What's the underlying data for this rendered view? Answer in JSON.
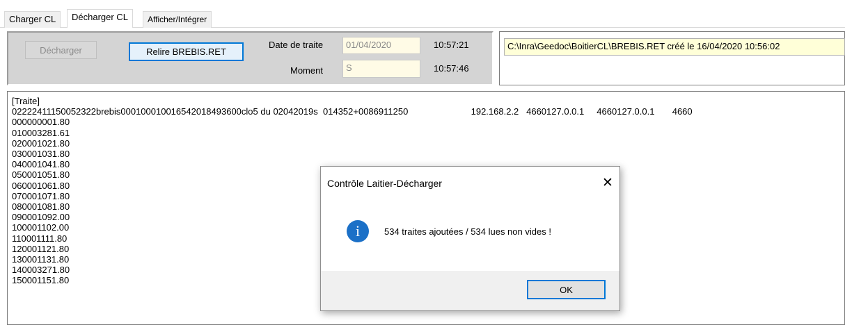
{
  "tabs": [
    {
      "label": "Charger CL"
    },
    {
      "label": "Décharger CL"
    },
    {
      "label": "Afficher/Intégrer"
    }
  ],
  "toolbar": {
    "decharger_label": "Décharger",
    "relire_label": "Relire BREBIS.RET",
    "date_label": "Date de traite",
    "date_value": "01/04/2020",
    "time1": "10:57:21",
    "moment_label": "Moment",
    "moment_value": "S",
    "time2": "10:57:46"
  },
  "status_path": "C:\\Inra\\Geedoc\\BoitierCL\\BREBIS.RET créé le 16/04/2020 10:56:02",
  "log_lines": [
    "[Traite]",
    "02222411150052322brebis00010001001654201849360​0clo5 du 02042019s  014352+0086911250                         192.168.2.2   4660127.0.0.1     4660127.0.0.1       4660",
    "000000001.80",
    "010003281.61",
    "020001021.80",
    "030001031.80",
    "040001041.80",
    "050001051.80",
    "060001061.80",
    "070001071.80",
    "080001081.80",
    "090001092.00",
    "100001102.00",
    "110001111.80",
    "120001121.80",
    "130001131.80",
    "140003271.80",
    "150001151.80"
  ],
  "dialog": {
    "title": "Contrôle Laitier-Décharger",
    "close_glyph": "✕",
    "icon_glyph": "i",
    "message": "534 traites ajoutées / 534 lues non vides !",
    "ok_label": "OK"
  },
  "colors": {
    "accent": "#0078d7",
    "info_icon": "#1b70c7",
    "field_bg": "#fffbe6",
    "panel_bg": "#d4d4d4"
  }
}
